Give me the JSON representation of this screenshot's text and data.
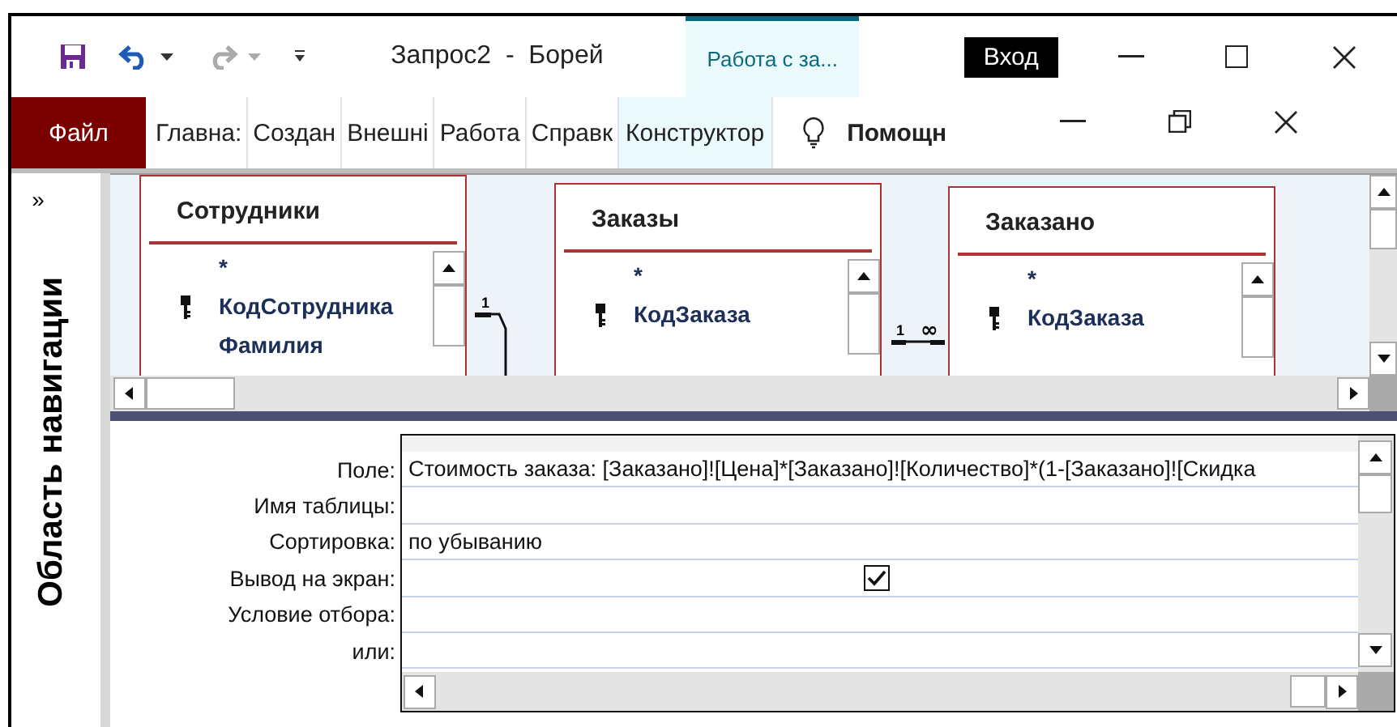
{
  "window": {
    "title": "Запрос2  -  Борей",
    "context_tab": "Работа с за...",
    "sign_in": "Вход"
  },
  "ribbon_tabs": [
    {
      "label": "Файл",
      "kind": "file"
    },
    {
      "label": "Главна:",
      "kind": "tab"
    },
    {
      "label": "Создан",
      "kind": "tab"
    },
    {
      "label": "Внешні",
      "kind": "tab"
    },
    {
      "label": "Работа",
      "kind": "tab"
    },
    {
      "label": "Справк",
      "kind": "tab"
    },
    {
      "label": "Конструктор",
      "kind": "context"
    }
  ],
  "tell_me": "Помощн",
  "navigation_pane": {
    "toggle": "»",
    "title": "Область навигации"
  },
  "tables": [
    {
      "title": "Сотрудники",
      "fields": [
        {
          "name": "*",
          "key": false
        },
        {
          "name": "КодСотрудника",
          "key": true
        },
        {
          "name": "Фамилия",
          "key": false
        }
      ]
    },
    {
      "title": "Заказы",
      "fields": [
        {
          "name": "*",
          "key": false
        },
        {
          "name": "КодЗаказа",
          "key": true
        }
      ]
    },
    {
      "title": "Заказано",
      "fields": [
        {
          "name": "*",
          "key": false
        },
        {
          "name": "КодЗаказа",
          "key": true
        }
      ]
    }
  ],
  "relations": [
    {
      "from_label": "1"
    },
    {
      "from_label": "1",
      "to_label": "∞"
    }
  ],
  "design_grid": [
    {
      "label": "Поле:",
      "kind": "text",
      "value": "Стоимость заказа: [Заказано]![Цена]*[Заказано]![Количество]*(1-[Заказано]![Скидка"
    },
    {
      "label": "Имя таблицы:",
      "kind": "text"
    },
    {
      "label": "Сортировка:",
      "kind": "text",
      "value": "по убыванию"
    },
    {
      "label": "Вывод на экран:",
      "kind": "checkbox",
      "checked": true
    },
    {
      "label": "Условие отбора:",
      "kind": "text"
    },
    {
      "label": "или:",
      "kind": "text"
    }
  ]
}
